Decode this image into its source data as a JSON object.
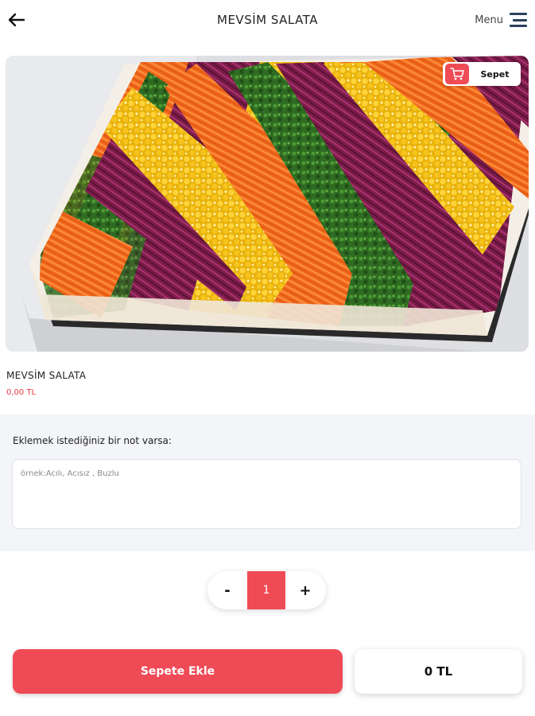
{
  "header": {
    "title": "MEVSİM SALATA",
    "menu_label": "Menu"
  },
  "cart": {
    "label": "Sepet"
  },
  "product": {
    "name": "MEVSİM SALATA",
    "price": "0,00 TL"
  },
  "note": {
    "label": "Eklemek istediğiniz bir not varsa:",
    "placeholder": "örnek:Acılı, Acısız , Buzlu",
    "value": ""
  },
  "quantity": {
    "minus_label": "-",
    "value": "1",
    "plus_label": "+"
  },
  "actions": {
    "add_to_cart_label": "Sepete Ekle",
    "total": "0 TL"
  },
  "colors": {
    "accent": "#ef4b57",
    "price": "#e23a45",
    "section_bg": "#f3f5f8"
  },
  "icons": {
    "back": "arrow-left-icon",
    "menu": "hamburger-icon",
    "cart": "shopping-cart-icon"
  }
}
